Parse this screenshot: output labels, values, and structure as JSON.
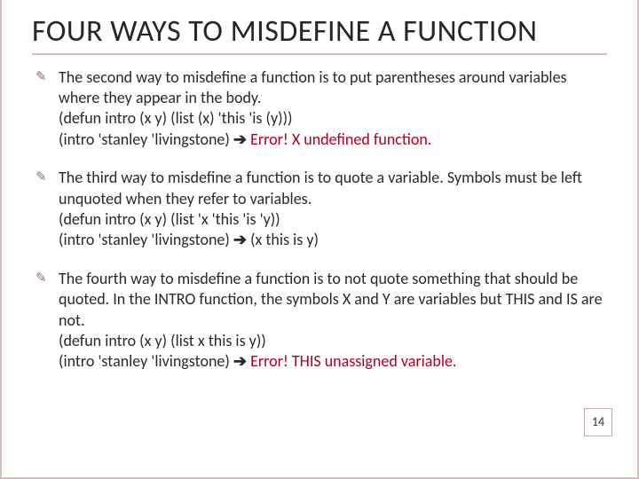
{
  "title": "FOUR WAYS TO MISDEFINE A FUNCTION",
  "arrow": "➔",
  "bullets": [
    {
      "lead": "The second way to misdefine a function is to put parentheses around variables where they appear in the body.",
      "code1": "(defun intro (x y) (list (x) 'this 'is (y)))",
      "call": "(intro 'stanley 'livingstone)",
      "result": "Error! X undefined function.",
      "result_is_error": true
    },
    {
      "lead": "The third way to misdefine a function is to quote a variable. Symbols must be left unquoted when they refer to variables.",
      "code1": "(defun intro (x y) (list 'x 'this 'is 'y))",
      "call": "(intro 'stanley 'livingstone)",
      "result": "(x this is y)",
      "result_is_error": false
    },
    {
      "lead": "The fourth way to misdefine a function is to not quote something that should be quoted. In the INTRO function, the symbols X and Y are variables but THIS and IS are not.",
      "code1": "(defun intro (x y) (list x this is y))",
      "call": "(intro 'stanley 'livingstone)",
      "result": "Error! THIS unassigned variable.",
      "result_is_error": true
    }
  ],
  "slide_number": "14"
}
